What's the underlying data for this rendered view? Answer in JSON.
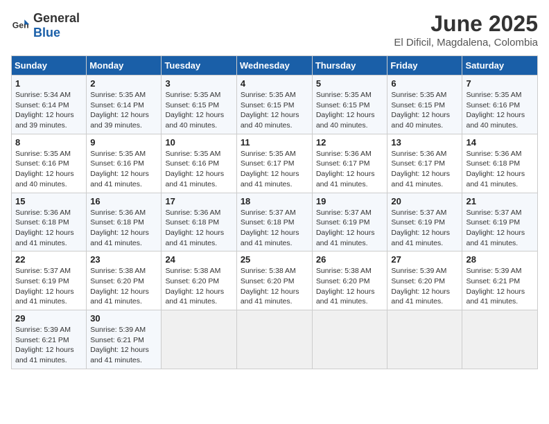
{
  "logo": {
    "general": "General",
    "blue": "Blue"
  },
  "header": {
    "title": "June 2025",
    "subtitle": "El Dificil, Magdalena, Colombia"
  },
  "weekdays": [
    "Sunday",
    "Monday",
    "Tuesday",
    "Wednesday",
    "Thursday",
    "Friday",
    "Saturday"
  ],
  "weeks": [
    [
      {
        "day": 1,
        "sunrise": "5:34 AM",
        "sunset": "6:14 PM",
        "daylight": "12 hours and 39 minutes."
      },
      {
        "day": 2,
        "sunrise": "5:35 AM",
        "sunset": "6:14 PM",
        "daylight": "12 hours and 39 minutes."
      },
      {
        "day": 3,
        "sunrise": "5:35 AM",
        "sunset": "6:15 PM",
        "daylight": "12 hours and 40 minutes."
      },
      {
        "day": 4,
        "sunrise": "5:35 AM",
        "sunset": "6:15 PM",
        "daylight": "12 hours and 40 minutes."
      },
      {
        "day": 5,
        "sunrise": "5:35 AM",
        "sunset": "6:15 PM",
        "daylight": "12 hours and 40 minutes."
      },
      {
        "day": 6,
        "sunrise": "5:35 AM",
        "sunset": "6:15 PM",
        "daylight": "12 hours and 40 minutes."
      },
      {
        "day": 7,
        "sunrise": "5:35 AM",
        "sunset": "6:16 PM",
        "daylight": "12 hours and 40 minutes."
      }
    ],
    [
      {
        "day": 8,
        "sunrise": "5:35 AM",
        "sunset": "6:16 PM",
        "daylight": "12 hours and 40 minutes."
      },
      {
        "day": 9,
        "sunrise": "5:35 AM",
        "sunset": "6:16 PM",
        "daylight": "12 hours and 41 minutes."
      },
      {
        "day": 10,
        "sunrise": "5:35 AM",
        "sunset": "6:16 PM",
        "daylight": "12 hours and 41 minutes."
      },
      {
        "day": 11,
        "sunrise": "5:35 AM",
        "sunset": "6:17 PM",
        "daylight": "12 hours and 41 minutes."
      },
      {
        "day": 12,
        "sunrise": "5:36 AM",
        "sunset": "6:17 PM",
        "daylight": "12 hours and 41 minutes."
      },
      {
        "day": 13,
        "sunrise": "5:36 AM",
        "sunset": "6:17 PM",
        "daylight": "12 hours and 41 minutes."
      },
      {
        "day": 14,
        "sunrise": "5:36 AM",
        "sunset": "6:18 PM",
        "daylight": "12 hours and 41 minutes."
      }
    ],
    [
      {
        "day": 15,
        "sunrise": "5:36 AM",
        "sunset": "6:18 PM",
        "daylight": "12 hours and 41 minutes."
      },
      {
        "day": 16,
        "sunrise": "5:36 AM",
        "sunset": "6:18 PM",
        "daylight": "12 hours and 41 minutes."
      },
      {
        "day": 17,
        "sunrise": "5:36 AM",
        "sunset": "6:18 PM",
        "daylight": "12 hours and 41 minutes."
      },
      {
        "day": 18,
        "sunrise": "5:37 AM",
        "sunset": "6:18 PM",
        "daylight": "12 hours and 41 minutes."
      },
      {
        "day": 19,
        "sunrise": "5:37 AM",
        "sunset": "6:19 PM",
        "daylight": "12 hours and 41 minutes."
      },
      {
        "day": 20,
        "sunrise": "5:37 AM",
        "sunset": "6:19 PM",
        "daylight": "12 hours and 41 minutes."
      },
      {
        "day": 21,
        "sunrise": "5:37 AM",
        "sunset": "6:19 PM",
        "daylight": "12 hours and 41 minutes."
      }
    ],
    [
      {
        "day": 22,
        "sunrise": "5:37 AM",
        "sunset": "6:19 PM",
        "daylight": "12 hours and 41 minutes."
      },
      {
        "day": 23,
        "sunrise": "5:38 AM",
        "sunset": "6:20 PM",
        "daylight": "12 hours and 41 minutes."
      },
      {
        "day": 24,
        "sunrise": "5:38 AM",
        "sunset": "6:20 PM",
        "daylight": "12 hours and 41 minutes."
      },
      {
        "day": 25,
        "sunrise": "5:38 AM",
        "sunset": "6:20 PM",
        "daylight": "12 hours and 41 minutes."
      },
      {
        "day": 26,
        "sunrise": "5:38 AM",
        "sunset": "6:20 PM",
        "daylight": "12 hours and 41 minutes."
      },
      {
        "day": 27,
        "sunrise": "5:39 AM",
        "sunset": "6:20 PM",
        "daylight": "12 hours and 41 minutes."
      },
      {
        "day": 28,
        "sunrise": "5:39 AM",
        "sunset": "6:21 PM",
        "daylight": "12 hours and 41 minutes."
      }
    ],
    [
      {
        "day": 29,
        "sunrise": "5:39 AM",
        "sunset": "6:21 PM",
        "daylight": "12 hours and 41 minutes."
      },
      {
        "day": 30,
        "sunrise": "5:39 AM",
        "sunset": "6:21 PM",
        "daylight": "12 hours and 41 minutes."
      },
      null,
      null,
      null,
      null,
      null
    ]
  ]
}
